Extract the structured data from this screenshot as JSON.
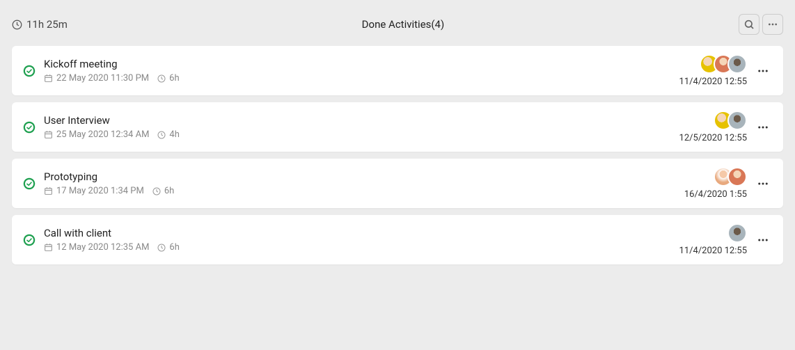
{
  "header": {
    "total_time": "11h 25m",
    "title": "Done Activities(4)"
  },
  "activities": [
    {
      "title": "Kickoff meeting",
      "date": "22 May 2020 11:30 PM",
      "duration": "6h",
      "avatars": [
        "avatar1",
        "avatar2",
        "avatar3"
      ],
      "completed_at": "11/4/2020 12:55"
    },
    {
      "title": "User Interview",
      "date": "25 May 2020 12:34 AM",
      "duration": "4h",
      "avatars": [
        "avatar1",
        "avatar3"
      ],
      "completed_at": "12/5/2020 12:55"
    },
    {
      "title": "Prototyping",
      "date": "17 May 2020 1:34 PM",
      "duration": "6h",
      "avatars": [
        "avatar4",
        "avatar2"
      ],
      "completed_at": "16/4/2020 1:55"
    },
    {
      "title": "Call with client",
      "date": "12 May 2020 12:35 AM",
      "duration": "6h",
      "avatars": [
        "avatar3"
      ],
      "completed_at": "11/4/2020 12:55"
    }
  ]
}
